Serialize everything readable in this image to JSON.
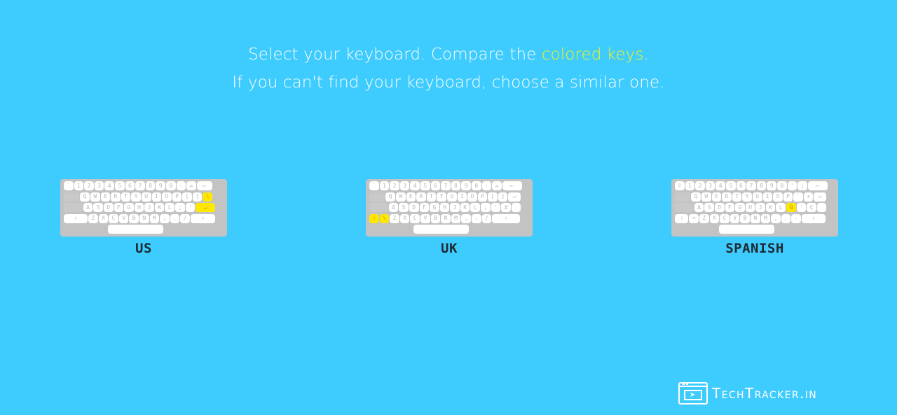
{
  "instructions": {
    "line1_prefix": "Select your keyboard. Compare the ",
    "line1_highlight": "colored keys",
    "line1_suffix": ".",
    "line2": "If you can't find your keyboard, choose a similar one."
  },
  "colors": {
    "background": "#3ecbfd",
    "highlight": "#ffe800",
    "text_highlight": "#f5f51b"
  },
  "keyboards": [
    {
      "label": "US",
      "rows": [
        [
          [
            "`",
            1
          ],
          [
            "1",
            1
          ],
          [
            "2",
            1
          ],
          [
            "3",
            1
          ],
          [
            "4",
            1
          ],
          [
            "5",
            1
          ],
          [
            "6",
            1
          ],
          [
            "7",
            1
          ],
          [
            "8",
            1
          ],
          [
            "9",
            1
          ],
          [
            "0",
            1
          ],
          [
            "-",
            1
          ],
          [
            "=",
            1
          ],
          [
            "⟵",
            1.6,
            "plain"
          ]
        ],
        [
          [
            "",
            1.6,
            "gray"
          ],
          [
            "Q",
            1
          ],
          [
            "W",
            1
          ],
          [
            "E",
            1
          ],
          [
            "R",
            1
          ],
          [
            "T",
            1
          ],
          [
            "Y",
            1
          ],
          [
            "U",
            1
          ],
          [
            "I",
            1
          ],
          [
            "O",
            1
          ],
          [
            "P",
            1
          ],
          [
            "[",
            1
          ],
          [
            "]",
            1
          ],
          [
            "\\",
            1,
            "hl"
          ]
        ],
        [
          [
            "",
            1.9,
            "gray"
          ],
          [
            "A",
            1
          ],
          [
            "S",
            1
          ],
          [
            "D",
            1
          ],
          [
            "F",
            1
          ],
          [
            "G",
            1
          ],
          [
            "H",
            1
          ],
          [
            "J",
            1
          ],
          [
            "K",
            1
          ],
          [
            "L",
            1
          ],
          [
            ";",
            1
          ],
          [
            "'",
            1
          ],
          [
            "↵",
            2,
            "hl"
          ]
        ],
        [
          [
            "⇧",
            2.4
          ],
          [
            "Z",
            1
          ],
          [
            "X",
            1
          ],
          [
            "C",
            1
          ],
          [
            "V",
            1
          ],
          [
            "B",
            1
          ],
          [
            "N",
            1
          ],
          [
            "M",
            1
          ],
          [
            ",",
            1
          ],
          [
            ".",
            1
          ],
          [
            "/",
            1
          ],
          [
            "⇧",
            2.5
          ]
        ],
        [
          [
            "",
            4.3,
            "blank"
          ],
          [
            "",
            5.5
          ],
          [
            "",
            4.3,
            "blank"
          ]
        ]
      ]
    },
    {
      "label": "UK",
      "rows": [
        [
          [
            "`",
            1
          ],
          [
            "1",
            1
          ],
          [
            "2",
            1
          ],
          [
            "3",
            1
          ],
          [
            "4",
            1
          ],
          [
            "5",
            1
          ],
          [
            "6",
            1
          ],
          [
            "7",
            1
          ],
          [
            "8",
            1
          ],
          [
            "9",
            1
          ],
          [
            "0",
            1
          ],
          [
            "-",
            1
          ],
          [
            "=",
            1
          ],
          [
            "⟵",
            2
          ]
        ],
        [
          [
            "",
            1.6,
            "gray"
          ],
          [
            "Q",
            1
          ],
          [
            "W",
            1
          ],
          [
            "E",
            1
          ],
          [
            "R",
            1
          ],
          [
            "T",
            1
          ],
          [
            "Y",
            1
          ],
          [
            "U",
            1
          ],
          [
            "I",
            1
          ],
          [
            "O",
            1
          ],
          [
            "P",
            1
          ],
          [
            "[",
            1
          ],
          [
            "]",
            1
          ],
          [
            "↵",
            1.3
          ]
        ],
        [
          [
            "",
            1.9,
            "gray"
          ],
          [
            "A",
            1
          ],
          [
            "S",
            1
          ],
          [
            "D",
            1
          ],
          [
            "F",
            1
          ],
          [
            "G",
            1
          ],
          [
            "H",
            1
          ],
          [
            "J",
            1
          ],
          [
            "K",
            1
          ],
          [
            "L",
            1
          ],
          [
            ";",
            1
          ],
          [
            "'",
            1
          ],
          [
            "#",
            1
          ],
          [
            "",
            1
          ]
        ],
        [
          [
            "⇧",
            1,
            "hl"
          ],
          [
            "\\",
            1,
            "hl"
          ],
          [
            "Z",
            1
          ],
          [
            "X",
            1
          ],
          [
            "C",
            1
          ],
          [
            "V",
            1
          ],
          [
            "B",
            1
          ],
          [
            "N",
            1
          ],
          [
            "M",
            1
          ],
          [
            ",",
            1
          ],
          [
            ".",
            1
          ],
          [
            "/",
            1
          ],
          [
            "⇧",
            2.8
          ]
        ],
        [
          [
            "",
            4.3,
            "blank"
          ],
          [
            "",
            5.5
          ],
          [
            "",
            4.3,
            "blank"
          ]
        ]
      ]
    },
    {
      "label": "SPANISH",
      "rows": [
        [
          [
            "º",
            1
          ],
          [
            "1",
            1
          ],
          [
            "2",
            1
          ],
          [
            "3",
            1
          ],
          [
            "4",
            1
          ],
          [
            "5",
            1
          ],
          [
            "6",
            1
          ],
          [
            "7",
            1
          ],
          [
            "8",
            1
          ],
          [
            "9",
            1
          ],
          [
            "0",
            1
          ],
          [
            "'",
            1
          ],
          [
            "¡",
            1
          ],
          [
            "⟵",
            2
          ]
        ],
        [
          [
            "",
            1.6,
            "gray"
          ],
          [
            "Q",
            1
          ],
          [
            "W",
            1
          ],
          [
            "E",
            1
          ],
          [
            "R",
            1
          ],
          [
            "T",
            1
          ],
          [
            "Y",
            1
          ],
          [
            "U",
            1
          ],
          [
            "I",
            1
          ],
          [
            "O",
            1
          ],
          [
            "P",
            1
          ],
          [
            "`",
            1
          ],
          [
            "+",
            1
          ],
          [
            "↵",
            1.3
          ]
        ],
        [
          [
            "",
            1.9,
            "gray"
          ],
          [
            "A",
            1
          ],
          [
            "S",
            1
          ],
          [
            "D",
            1
          ],
          [
            "F",
            1
          ],
          [
            "G",
            1
          ],
          [
            "H",
            1
          ],
          [
            "J",
            1
          ],
          [
            "K",
            1
          ],
          [
            "L",
            1
          ],
          [
            "Ñ",
            1,
            "hl"
          ],
          [
            "´",
            1
          ],
          [
            "Ç",
            1
          ],
          [
            "",
            1
          ]
        ],
        [
          [
            "⇧",
            1.4
          ],
          [
            "<",
            1
          ],
          [
            "Z",
            1
          ],
          [
            "X",
            1
          ],
          [
            "C",
            1
          ],
          [
            "V",
            1
          ],
          [
            "B",
            1
          ],
          [
            "N",
            1
          ],
          [
            "M",
            1
          ],
          [
            ",",
            1
          ],
          [
            ".",
            1
          ],
          [
            "-",
            1
          ],
          [
            "⇧",
            2.4
          ]
        ],
        [
          [
            "",
            4.3,
            "blank"
          ],
          [
            "",
            5.5
          ],
          [
            "",
            4.3,
            "blank"
          ]
        ]
      ]
    }
  ],
  "brand": {
    "text": "TechTracker.in",
    "icon": "browser-cursor-icon"
  }
}
